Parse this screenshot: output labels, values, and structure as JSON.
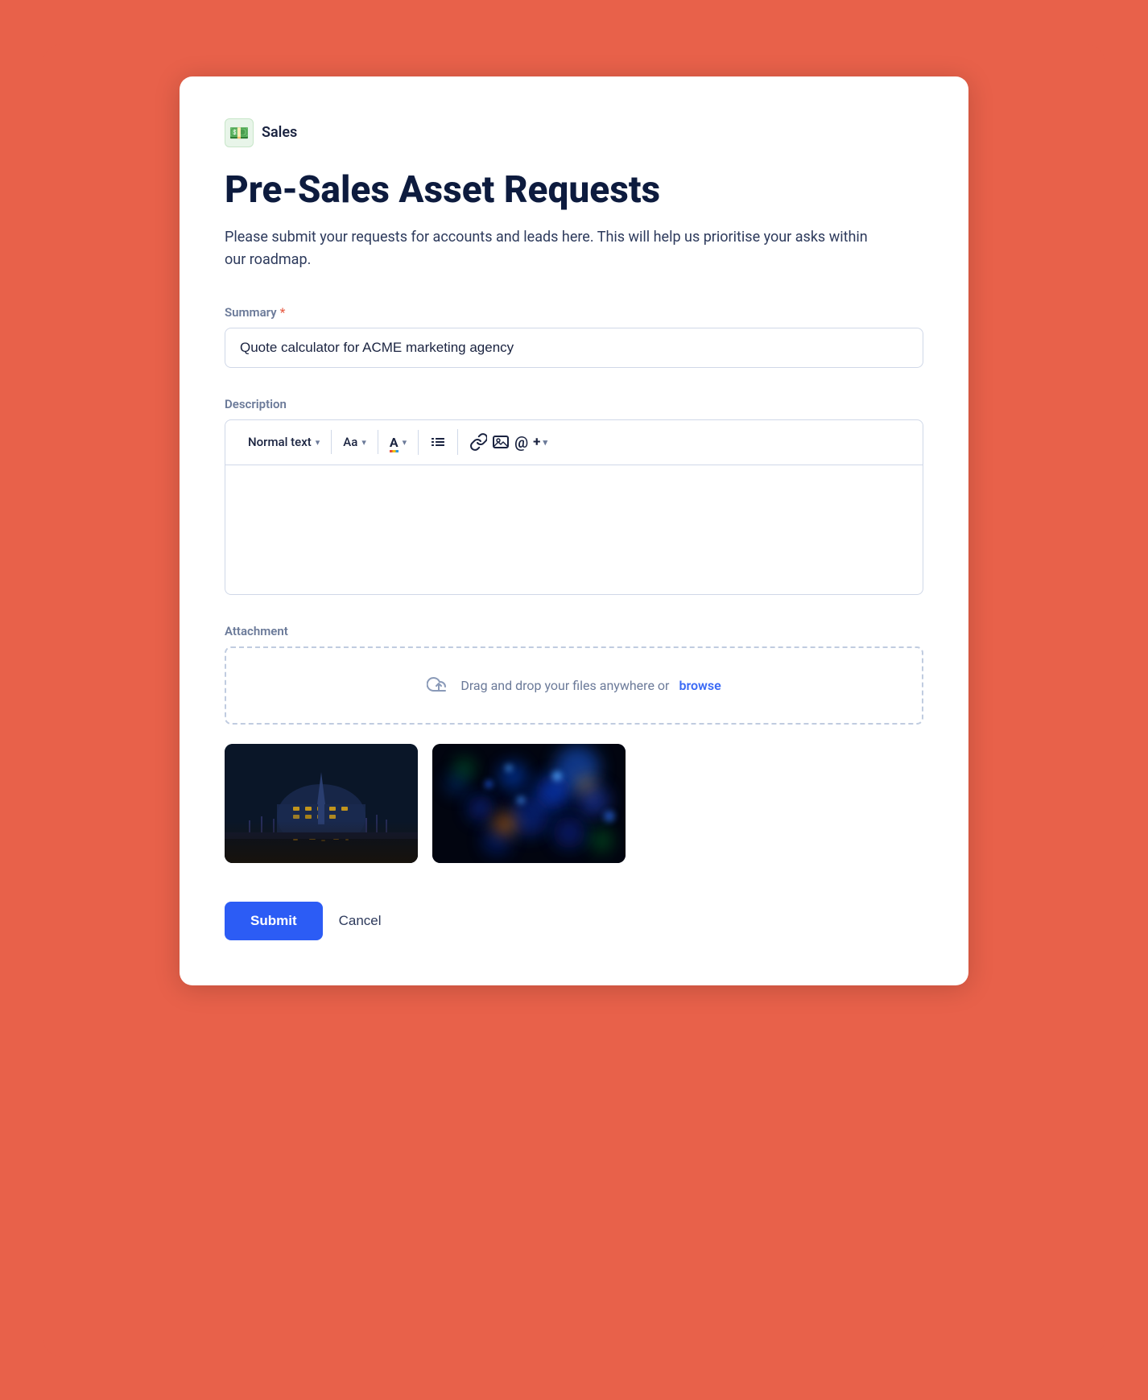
{
  "brand": {
    "icon": "💵",
    "label": "Sales"
  },
  "page": {
    "title": "Pre-Sales Asset Requests",
    "description": "Please submit your requests for accounts and leads here. This will help us prioritise your asks within our roadmap."
  },
  "form": {
    "summary": {
      "label": "Summary",
      "required": true,
      "value": "Quote calculator for ACME marketing agency"
    },
    "description": {
      "label": "Description",
      "toolbar": {
        "text_style": "Normal text",
        "font": "Aa",
        "color": "A",
        "list": "≡",
        "link": "🔗",
        "image": "🖼",
        "mention": "@",
        "more": "+"
      }
    },
    "attachment": {
      "label": "Attachment",
      "drag_text": "Drag and drop your files anywhere or",
      "browse_text": "browse"
    }
  },
  "buttons": {
    "submit": "Submit",
    "cancel": "Cancel"
  }
}
